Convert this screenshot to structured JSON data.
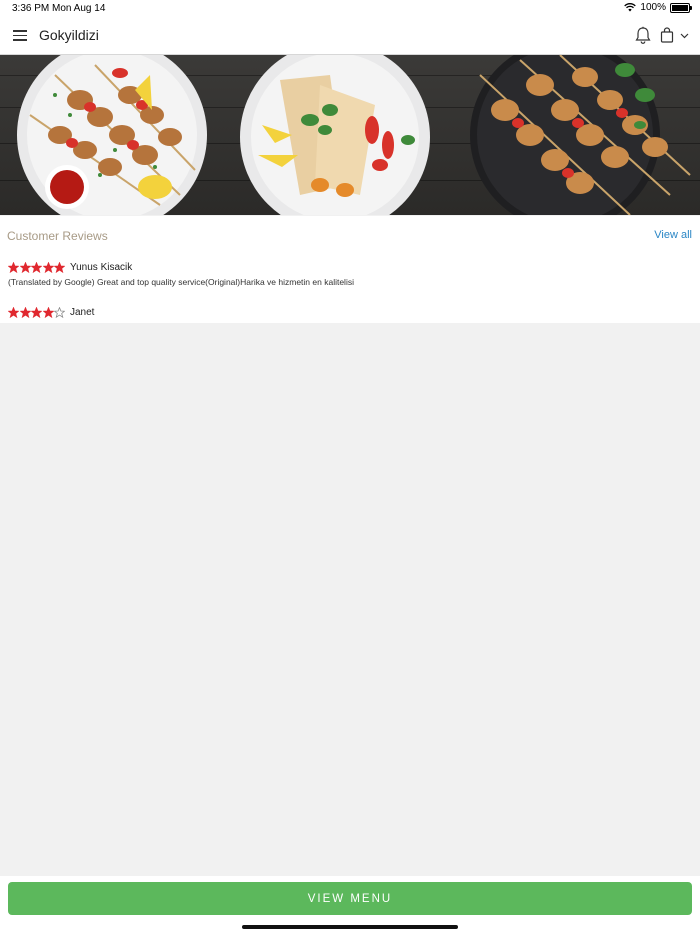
{
  "status_bar": {
    "time": "3:36 PM",
    "date": "Mon Aug 14",
    "battery": "100%",
    "icons": [
      "wifi-icon",
      "battery-icon"
    ]
  },
  "header": {
    "title": "Gokyildizi",
    "icons": [
      "menu-icon",
      "bell-icon",
      "shopping-bag-icon",
      "chevron-down-icon"
    ]
  },
  "banner": {
    "description_icons": [
      "chicken-skewer-plate",
      "wrap-plate",
      "kebab-skewer-plate"
    ]
  },
  "reviews": {
    "heading": "Customer Reviews",
    "view_all": "View all",
    "items": [
      {
        "name": "Yunus Kisacik",
        "rating": 5,
        "text": "(Translated by Google) Great and top quality service(Original)Harika ve hizmetin en kalitelisi"
      },
      {
        "name": "Janet",
        "rating": 4,
        "text": ""
      }
    ]
  },
  "footer": {
    "view_menu_label": "VIEW MENU"
  },
  "colors": {
    "accent_green": "#5cb85c",
    "star_red": "#e0282f",
    "link_blue": "#2a86c5",
    "heading_tan": "#a79a86"
  }
}
